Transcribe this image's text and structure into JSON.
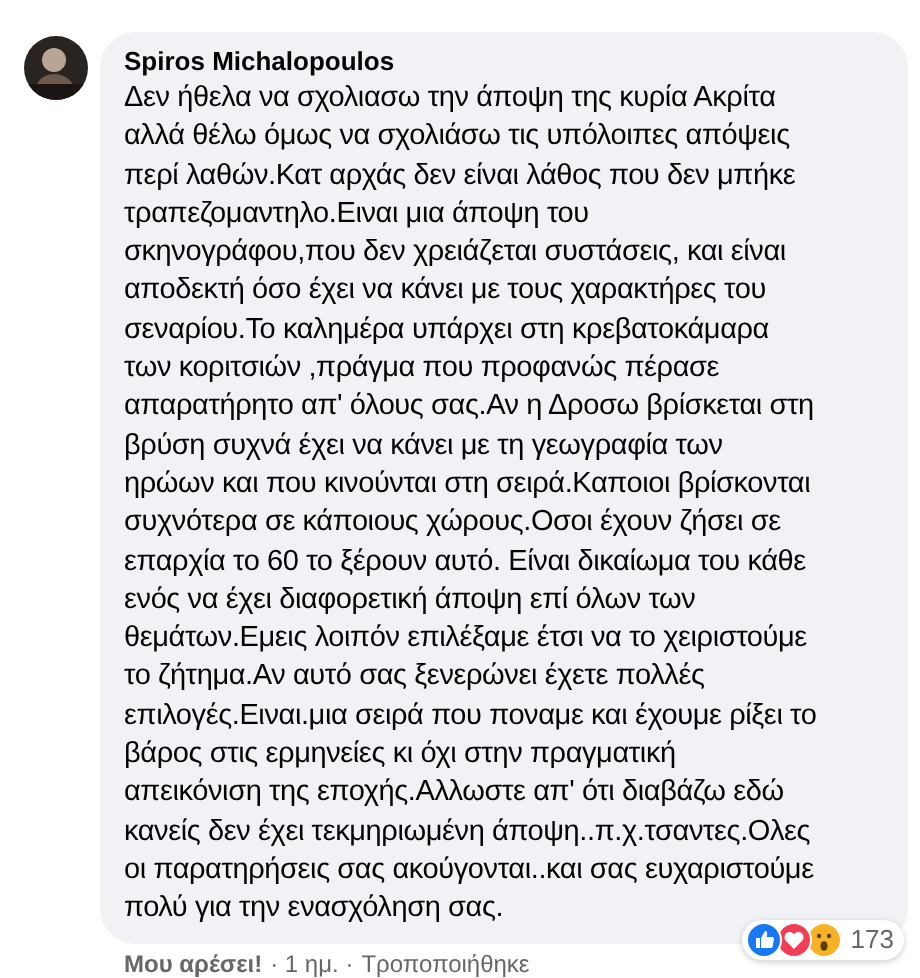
{
  "comment": {
    "author": "Spiros Michalopoulos",
    "text": "Δεν ήθελα να σχολιασω την άποψη της κυρία Ακρίτα\nαλλά θέλω όμως να σχολιάσω τις υπόλοιπες απόψεις\nπερί λαθών.Κατ αρχάς δεν είναι λάθος που δεν μπήκε\nτραπεζομαντηλο.Ειναι μια άποψη του\nσκηνογράφου,που δεν χρειάζεται συστάσεις, και είναι\nαποδεκτή όσο έχει να κάνει με τους χαρακτήρες του\nσεναρίου.Το καλημέρα υπάρχει στη κρεβατοκάμαρα\nτων κοριτσιών ,πράγμα που προφανώς πέρασε\nαπαρατήρητο απ' όλους σας.Αν η Δροσω βρίσκεται στη\nβρύση συχνά έχει να κάνει με τη γεωγραφία των\nηρώων και που κινούνται στη σειρά.Καποιοι βρίσκονται\nσυχνότερα σε κάποιους χώρους.Οσοι έχουν ζήσει σε\nεπαρχία το 60 το ξέρουν αυτό. Είναι δικαίωμα του κάθε\nενός να έχει διαφορετική άποψη επί όλων των\nθεμάτων.Εμεις λοιπόν επιλέξαμε έτσι να το χειριστούμε\nτο ζήτημα.Αν αυτό σας ξενερώνει έχετε πολλές\nεπιλογές.Ειναι.μια σειρά που ποναμε και έχουμε ρίξει το\nβάρος στις ερμηνείες κι όχι στην πραγματική\nαπεικόνιση της εποχής.Αλλωστε απ' ότι διαβάζω εδώ\nκανείς δεν έχει τεκμηριωμένη άποψη..π.χ.τσαντες.Ολες\nοι παρατηρήσεις σας ακούγονται..και σας ευχαριστούμε\nπολύ για την ενασχόληση σας.",
    "reactions": [
      {
        "kind": "like"
      },
      {
        "kind": "love"
      },
      {
        "kind": "wow"
      }
    ],
    "reaction_count": "173",
    "like_action": "Μου αρέσει!",
    "time": "· 1 ημ. ·",
    "edited": "Τροποποιήθηκε"
  }
}
